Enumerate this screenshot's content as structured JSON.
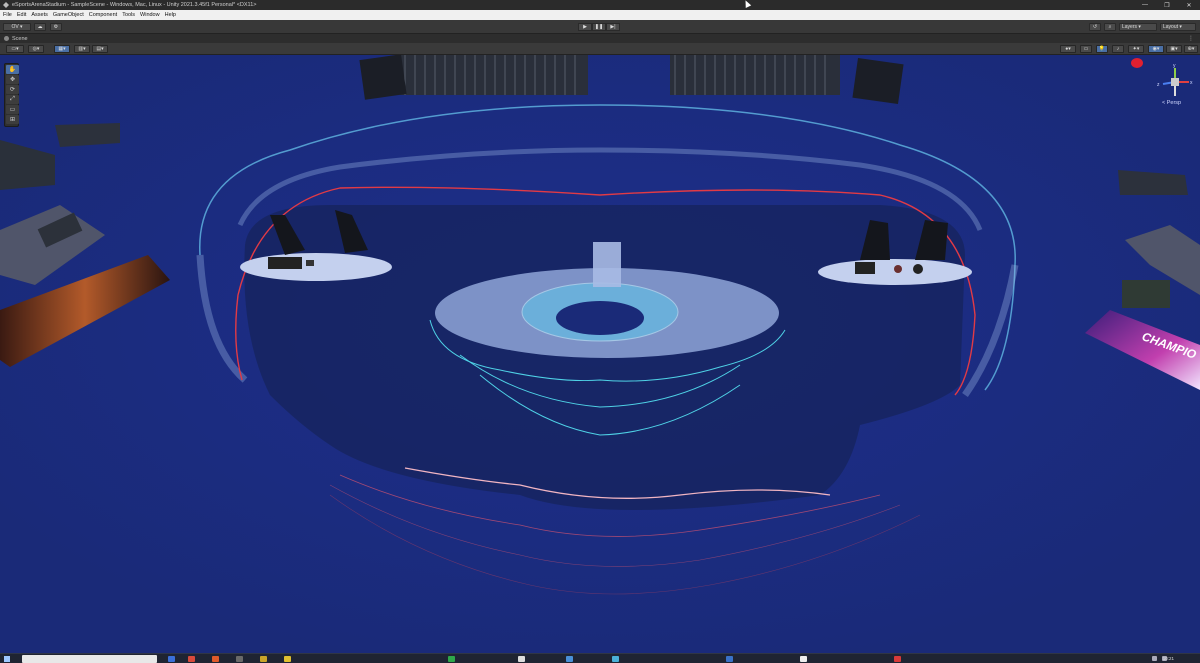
{
  "window": {
    "title": "eSportsArenaStadium - SampleScene - Windows, Mac, Linux - Unity 2021.3.45f1 Personal* <DX11>",
    "controls": [
      "—",
      "❐",
      "✕"
    ]
  },
  "menu": [
    "File",
    "Edit",
    "Assets",
    "GameObject",
    "Component",
    "Tools",
    "Window",
    "Help"
  ],
  "toolbar": {
    "account_label": "OV ▾",
    "play_icons": [
      "▶",
      "❚❚",
      "▶|"
    ],
    "layers_label": "Layers",
    "layout_label": "Layout"
  },
  "scene_tab": {
    "label": "Scene"
  },
  "scene_toolbar": {
    "left_buttons": [
      "▭▾",
      "◎▾",
      "▦▾",
      "▥▾",
      "▤▾"
    ],
    "right_buttons": [
      "●▾",
      "▭",
      "💡",
      "♪",
      "✦▾",
      "◉▾",
      "▣▾",
      "⊕▾"
    ]
  },
  "tools": [
    "✋",
    "✥",
    "⟳",
    "⤢",
    "▭",
    "⊞"
  ],
  "gizmo": {
    "x_label": "x",
    "y_label": "y",
    "z_label": "z",
    "view_label": "< Persp"
  },
  "scene": {
    "banner_right": "CHAMPIO",
    "colors": {
      "floor": "#1d2c86",
      "stage": "#8fa6d8",
      "cyan_lines": "#4fd2e6",
      "red_lines": "#e23a45"
    }
  },
  "taskbar": {
    "clock": "10:21"
  }
}
